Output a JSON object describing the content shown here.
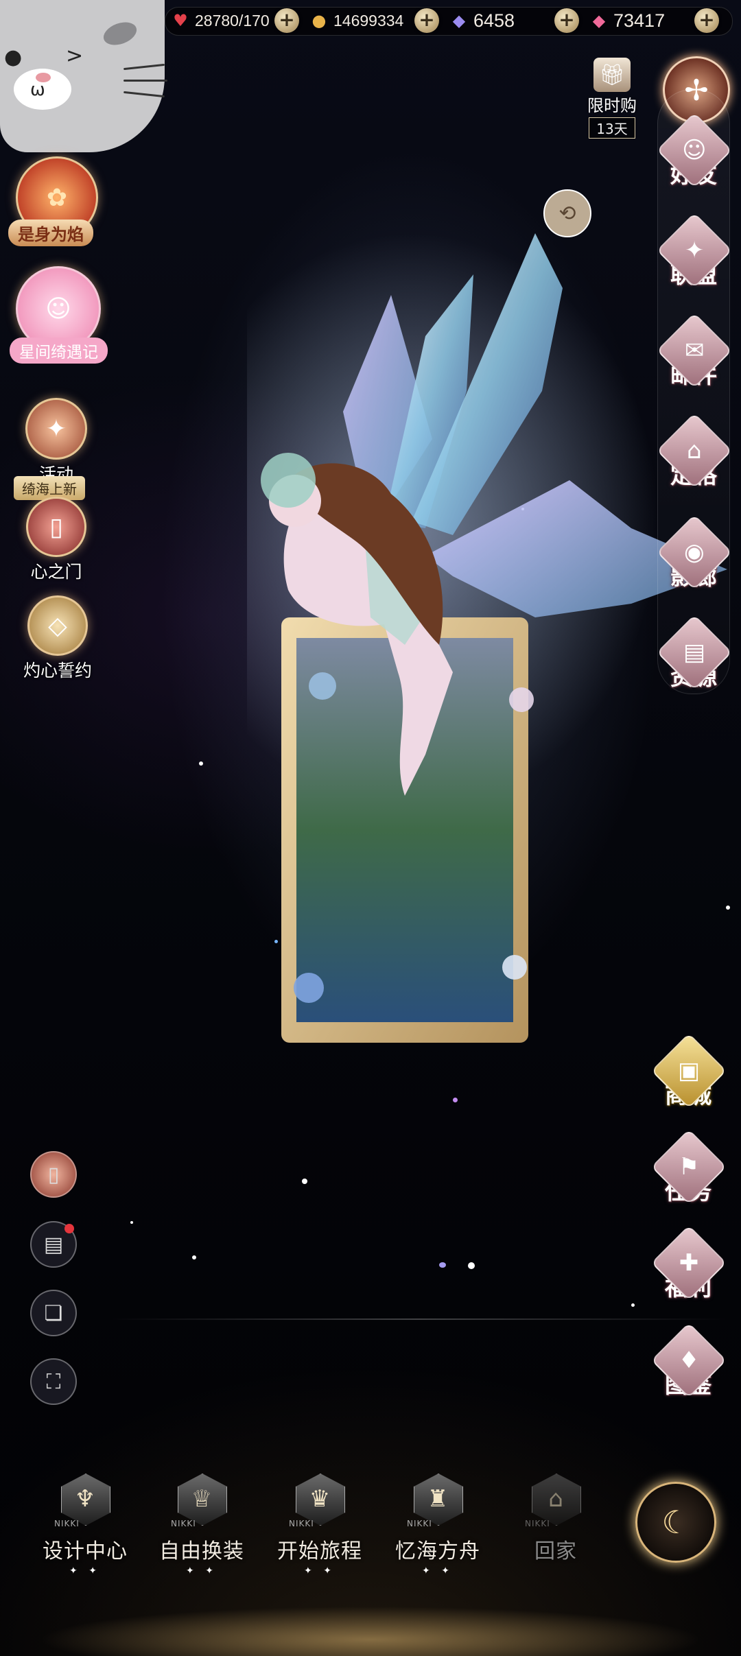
{
  "top_bar": {
    "stamina": "28780/170",
    "gold": "14699334",
    "diamonds_blue": "6458",
    "diamonds_pink": "73417",
    "stamina_icon": "heart-icon",
    "gold_icon": "cat-coin-icon",
    "blue_icon": "blue-diamond-icon",
    "pink_icon": "pink-diamond-icon",
    "plus": "+"
  },
  "left_events": {
    "event1_label": "是身为焰",
    "event2_label": "星间绮遇记",
    "activity_label": "活动",
    "activity_tag": "绮海上新",
    "heart_door_label": "心之门",
    "pledge_label": "灼心誓约"
  },
  "limited_shop": {
    "label": "限时购",
    "days": "13天"
  },
  "right_menu": {
    "friends": "好友",
    "alliance": "联盟",
    "mail": "邮件",
    "pose": "定格",
    "gallery": "影廊",
    "resources": "资源",
    "shop": "商城",
    "tasks": "任务",
    "welfare": "福利",
    "catalog": "图鉴"
  },
  "bottom_nav": {
    "design": "设计中心",
    "wardrobe": "自由换装",
    "journey": "开始旅程",
    "ark": "忆海方舟",
    "home": "回家",
    "crest_text": "NIKKI"
  },
  "colors": {
    "accent_gold": "#e6c796",
    "menu_pink": "#9e6f7b",
    "background": "#05060c"
  }
}
